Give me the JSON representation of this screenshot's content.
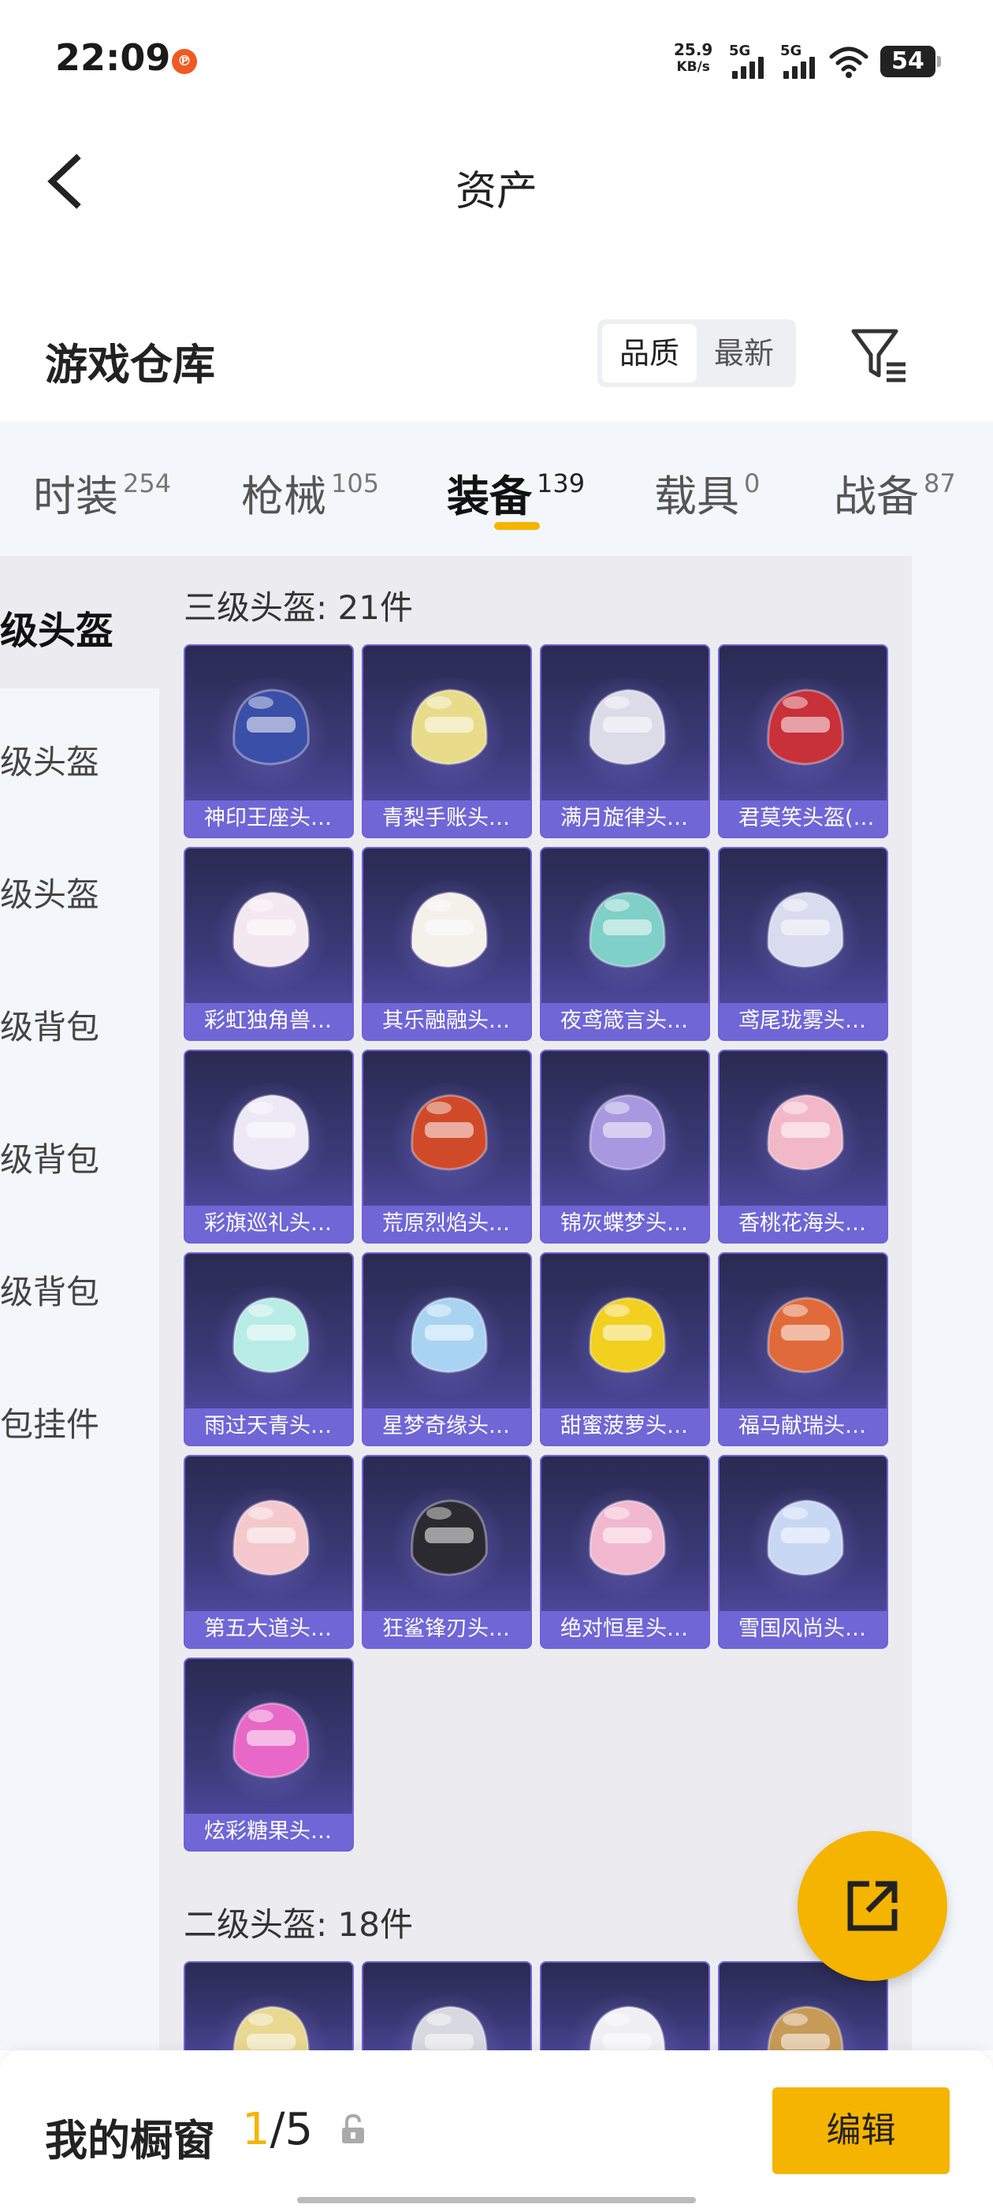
{
  "status_bar": {
    "time": "22:09",
    "notif_badge": "℗",
    "net_speed_value": "25.9",
    "net_speed_unit": "KB/s",
    "signal1_label": "5G",
    "signal2_label": "5G",
    "battery": "54",
    "icons": [
      "notification-icon",
      "signal-icon",
      "signal-icon",
      "wifi-icon",
      "battery-icon"
    ]
  },
  "header": {
    "title": "资产",
    "back_icon": "chevron-left-icon"
  },
  "warehouse": {
    "title": "游戏仓库",
    "sort_options": [
      "品质",
      "最新"
    ],
    "sort_selected": "品质",
    "filter_icon": "filter-icon"
  },
  "tabs": [
    {
      "label": "时装",
      "count": "254"
    },
    {
      "label": "枪械",
      "count": "105"
    },
    {
      "label": "装备",
      "count": "139"
    },
    {
      "label": "载具",
      "count": "0"
    },
    {
      "label": "战备",
      "count": "87"
    }
  ],
  "active_tab": "装备",
  "sidebar": {
    "items": [
      "级头盔",
      "级头盔",
      "级头盔",
      "级背包",
      "级背包",
      "级背包",
      "包挂件"
    ]
  },
  "sections": [
    {
      "title": "三级头盔: 21件",
      "items": [
        "神印王座头…",
        "青梨手账头…",
        "满月旋律头…",
        "君莫笑头盔(…",
        "彩虹独角兽…",
        "其乐融融头…",
        "夜鸢箴言头…",
        "鸢尾珑雾头…",
        "彩旗巡礼头…",
        "荒原烈焰头…",
        "锦灰蝶梦头…",
        "香桃花海头…",
        "雨过天青头…",
        "星梦奇缘头…",
        "甜蜜菠萝头…",
        "福马献瑞头…",
        "第五大道头…",
        "狂鲨锋刃头…",
        "绝对恒星头…",
        "雪国风尚头…",
        "炫彩糖果头…"
      ]
    },
    {
      "title": "二级头盔: 18件",
      "items": []
    }
  ],
  "helmet_colors": [
    "#3a4fa8",
    "#e8dc8a",
    "#dcdce8",
    "#c8303a",
    "#f3e8f0",
    "#f4f0ea",
    "#7fd0c8",
    "#d8dcee",
    "#ece8f6",
    "#d04a2a",
    "#a898e0",
    "#f2b8c8",
    "#b8ece6",
    "#a8d4f2",
    "#f2d020",
    "#e06a3a",
    "#f4c8cc",
    "#2a2a30",
    "#f2b8d0",
    "#c8d8f4",
    "#e868c8",
    "#e8d890",
    "#d8d8e0",
    "#f0f0f4",
    "#c89a58"
  ],
  "bottom_bar": {
    "label": "我的橱窗",
    "current": "1",
    "separator": "/",
    "total": "5",
    "edit_label": "编辑",
    "lock_icon": "lock-icon"
  },
  "fab": {
    "icon": "share-icon"
  }
}
